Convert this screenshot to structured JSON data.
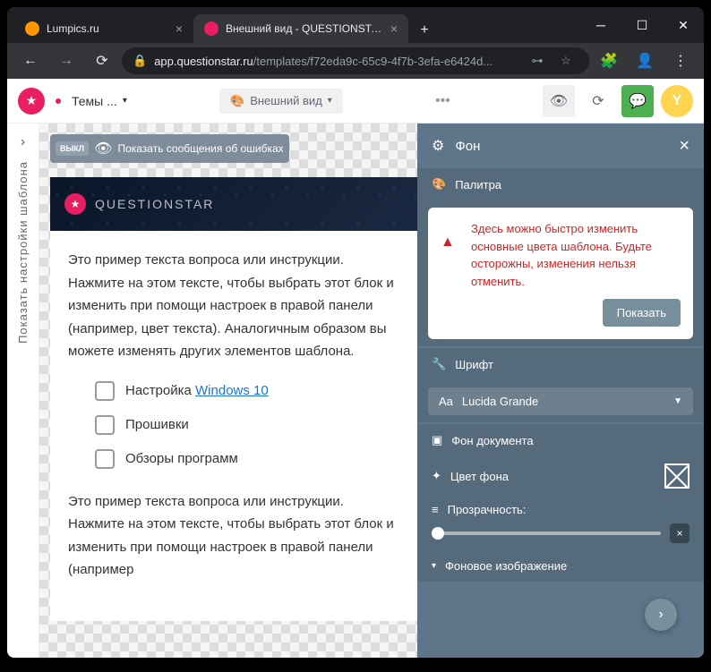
{
  "window": {
    "tab1_title": "Lumpics.ru",
    "tab2_title": "Внешний вид - QUESTIONSTAR",
    "url_domain": "app.questionstar.ru",
    "url_path": "/templates/f72eda9c-65c9-4f7b-3efa-e6424d..."
  },
  "toolbar": {
    "breadcrumb": "Темы ...",
    "view_btn": "Внешний вид",
    "avatar_letter": "Y"
  },
  "sidebar": {
    "vertical_label": "Показать настройки шаблона"
  },
  "canvas": {
    "toggle_badge": "ВЫКЛ",
    "toggle_text": "Показать сообщения об ошибках",
    "brand": "QUESTIONSTAR",
    "paragraph1": "Это пример текста вопроса или инструкции. Нажмите на этом тексте, чтобы выбрать этот блок и изменить при помощи настроек в правой панели (например, цвет текста). Аналогичным образом вы можете изменять других элементов шаблона.",
    "paragraph2": "Это пример текста вопроса или инструкции. Нажмите на этом тексте, чтобы выбрать этот блок и изменить при помощи настроек в правой панели (например",
    "option1_prefix": "Настройка ",
    "option1_link": "Windows 10",
    "option2": "Прошивки",
    "option3": "Обзоры программ"
  },
  "panel": {
    "title": "Фон",
    "section_palette": "Палитра",
    "palette_warning": "Здесь можно быстро изменить основные цвета шаблона. Будьте осторожны, изменения нельзя отменить.",
    "show_btn": "Показать",
    "section_font": "Шрифт",
    "font_value": "Lucida Grande",
    "section_docbg": "Фон документа",
    "row_bgcolor": "Цвет фона",
    "row_opacity": "Прозрачность:",
    "section_bgimage": "Фоновое изображение"
  }
}
